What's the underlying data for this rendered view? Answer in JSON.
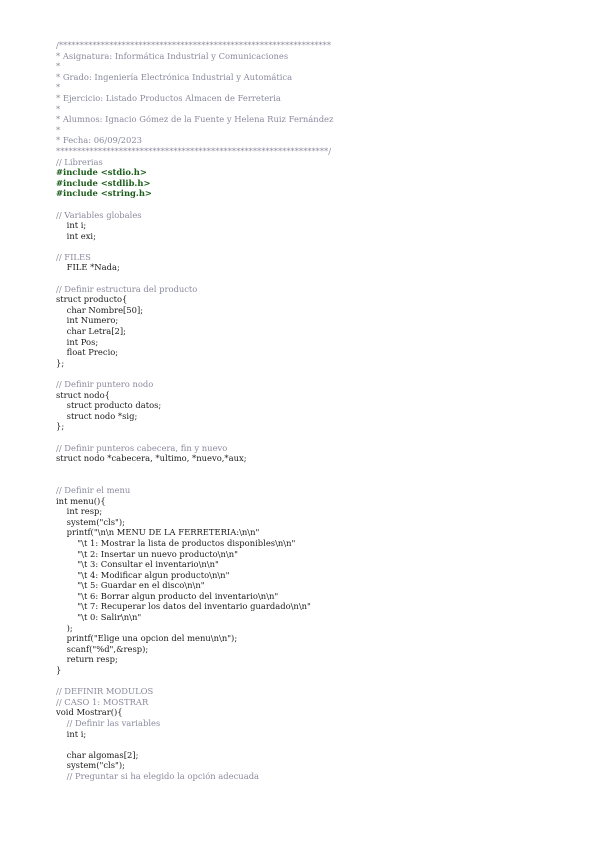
{
  "document": {
    "lines": [
      {
        "cls": "cm",
        "text": "/*****************************************************************"
      },
      {
        "cls": "cm",
        "text": "* Asignatura: Informática Industrial y Comunicaciones"
      },
      {
        "cls": "cm",
        "text": "*"
      },
      {
        "cls": "cm",
        "text": "* Grado: Ingeniería Electrónica Industrial y Automática"
      },
      {
        "cls": "cm",
        "text": "*"
      },
      {
        "cls": "cm",
        "text": "* Ejercicio: Listado Productos Almacen de Ferreteria"
      },
      {
        "cls": "cm",
        "text": "*"
      },
      {
        "cls": "cm",
        "text": "* Alumnos: Ignacio Gómez de la Fuente y Helena Ruiz Fernández"
      },
      {
        "cls": "cm",
        "text": "*"
      },
      {
        "cls": "cm",
        "text": "* Fecha: 06/09/2023"
      },
      {
        "cls": "cm",
        "text": "*****************************************************************/"
      },
      {
        "cls": "cm",
        "text": "// Librerias"
      },
      {
        "cls": "pp",
        "text": "#include <stdio.h>"
      },
      {
        "cls": "pp",
        "text": "#include <stdlib.h>"
      },
      {
        "cls": "pp",
        "text": "#include <string.h>"
      },
      {
        "cls": "",
        "text": " "
      },
      {
        "cls": "cm",
        "text": "// Variables globales"
      },
      {
        "cls": "",
        "text": "    int i;"
      },
      {
        "cls": "",
        "text": "    int exi;"
      },
      {
        "cls": "",
        "text": " "
      },
      {
        "cls": "cm",
        "text": "// FILES"
      },
      {
        "cls": "",
        "text": "    FILE *Nada;"
      },
      {
        "cls": "",
        "text": " "
      },
      {
        "cls": "cm",
        "text": "// Definir estructura del producto"
      },
      {
        "cls": "",
        "text": "struct producto{"
      },
      {
        "cls": "",
        "text": "    char Nombre[50];"
      },
      {
        "cls": "",
        "text": "    int Numero;"
      },
      {
        "cls": "",
        "text": "    char Letra[2];"
      },
      {
        "cls": "",
        "text": "    int Pos;"
      },
      {
        "cls": "",
        "text": "    float Precio;"
      },
      {
        "cls": "",
        "text": "};"
      },
      {
        "cls": "",
        "text": " "
      },
      {
        "cls": "cm",
        "text": "// Definir puntero nodo"
      },
      {
        "cls": "",
        "text": "struct nodo{"
      },
      {
        "cls": "",
        "text": "    struct producto datos;"
      },
      {
        "cls": "",
        "text": "    struct nodo *sig;"
      },
      {
        "cls": "",
        "text": "};"
      },
      {
        "cls": "",
        "text": " "
      },
      {
        "cls": "cm",
        "text": "// Definir punteros cabecera, fin y nuevo"
      },
      {
        "cls": "",
        "text": "struct nodo *cabecera, *ultimo, *nuevo,*aux;"
      },
      {
        "cls": "",
        "text": " "
      },
      {
        "cls": "",
        "text": " "
      },
      {
        "cls": "cm",
        "text": "// Definir el menu"
      },
      {
        "cls": "",
        "text": "int menu(){"
      },
      {
        "cls": "",
        "text": "    int resp;"
      },
      {
        "cls": "",
        "text": "    system(\"cls\");"
      },
      {
        "cls": "",
        "text": "    printf(\"\\n\\n MENU DE LA FERRETERIA:\\n\\n\""
      },
      {
        "cls": "",
        "text": "        \"\\t 1: Mostrar la lista de productos disponibles\\n\\n\""
      },
      {
        "cls": "",
        "text": "        \"\\t 2: Insertar un nuevo producto\\n\\n\""
      },
      {
        "cls": "",
        "text": "        \"\\t 3: Consultar el inventario\\n\\n\""
      },
      {
        "cls": "",
        "text": "        \"\\t 4: Modificar algun producto\\n\\n\""
      },
      {
        "cls": "",
        "text": "        \"\\t 5: Guardar en el disco\\n\\n\""
      },
      {
        "cls": "",
        "text": "        \"\\t 6: Borrar algun producto del inventario\\n\\n\""
      },
      {
        "cls": "",
        "text": "        \"\\t 7: Recuperar los datos del inventario guardado\\n\\n\""
      },
      {
        "cls": "",
        "text": "        \"\\t 0: Salir\\n\\n\""
      },
      {
        "cls": "",
        "text": "    );"
      },
      {
        "cls": "",
        "text": "    printf(\"Elige una opcion del menu\\n\\n\");"
      },
      {
        "cls": "",
        "text": "    scanf(\"%d\",&resp);"
      },
      {
        "cls": "",
        "text": "    return resp;"
      },
      {
        "cls": "",
        "text": "}"
      },
      {
        "cls": "",
        "text": " "
      },
      {
        "cls": "cm",
        "text": "// DEFINIR MODULOS"
      },
      {
        "cls": "cm",
        "text": "// CASO 1: MOSTRAR"
      },
      {
        "cls": "",
        "text": "void Mostrar(){"
      },
      {
        "cls": "cm",
        "text": "    // Definir las variables"
      },
      {
        "cls": "",
        "text": "    int i;"
      },
      {
        "cls": "",
        "text": " "
      },
      {
        "cls": "",
        "text": "    char algomas[2];"
      },
      {
        "cls": "",
        "text": "    system(\"cls\");"
      },
      {
        "cls": "cm",
        "text": "    // Preguntar si ha elegido la opción adecuada"
      }
    ]
  }
}
